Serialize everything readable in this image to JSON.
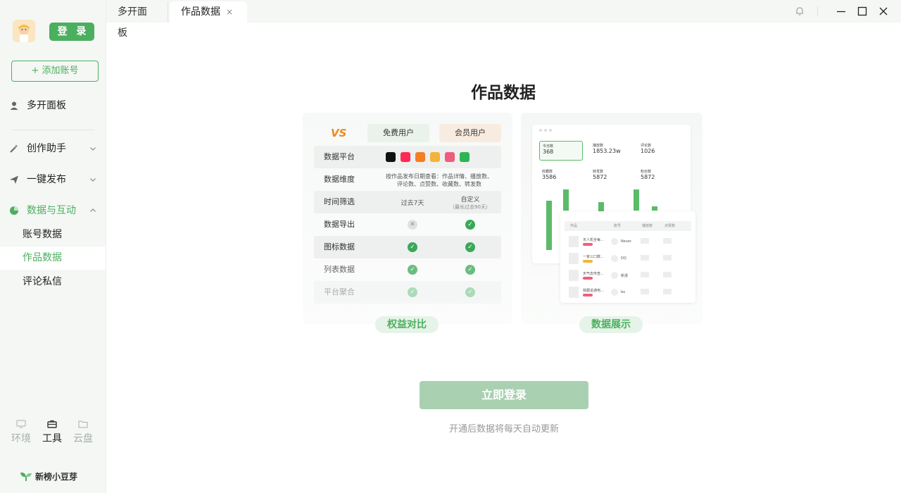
{
  "sidebar": {
    "login_label": "登 录",
    "add_account_label": "+ 添加账号",
    "nav": {
      "multi_panel": "多开面板",
      "creation_assistant": "创作助手",
      "one_click_publish": "一键发布",
      "data_interaction": "数据与互动"
    },
    "sub_items": [
      "账号数据",
      "作品数据",
      "评论私信"
    ],
    "bottom_tabs": [
      "环境",
      "工具",
      "云盘"
    ],
    "brand": "新榜小豆芽"
  },
  "tabs": [
    {
      "label": "多开面板"
    },
    {
      "label": "作品数据",
      "close": "×"
    }
  ],
  "main": {
    "title": "作品数据",
    "compare": {
      "vs": "VS",
      "free_header": "免费用户",
      "member_header": "会员用户",
      "rows": [
        {
          "label": "数据平台"
        },
        {
          "label": "数据维度",
          "free": "按作品发布日期查看：作品详情、播放数、评论数、点赞数、收藏数、转发数"
        },
        {
          "label": "时间筛选",
          "free": "过去7天",
          "member": "自定义",
          "member_note": "（最长过去90天）"
        },
        {
          "label": "数据导出",
          "free": "no",
          "member": "yes"
        },
        {
          "label": "图标数据",
          "free": "yes",
          "member": "yes"
        },
        {
          "label": "列表数据",
          "free": "yes",
          "member": "yes"
        },
        {
          "label": "平台聚合",
          "free": "yes",
          "member": "yes"
        }
      ]
    },
    "preview": {
      "stats": [
        {
          "label": "今日数",
          "value": "368"
        },
        {
          "label": "播放数",
          "value": "1853.23w"
        },
        {
          "label": "评论数",
          "value": "1026"
        },
        {
          "label": "收藏数",
          "value": "3586"
        },
        {
          "label": "转发数",
          "value": "5872"
        },
        {
          "label": "粉丝数",
          "value": "5872"
        }
      ],
      "table_headers": [
        "作品",
        "账号",
        "播放数",
        "点赞数"
      ],
      "table_rows": [
        {
          "title": "无人机全每...",
          "account": "Never"
        },
        {
          "title": "一家三口数...",
          "account": "DQ"
        },
        {
          "title": "天气去传查...",
          "account": "新漫"
        },
        {
          "title": "我跟说通电...",
          "account": "bo"
        }
      ]
    },
    "pill_compare": "权益对比",
    "pill_display": "数据展示",
    "cta_label": "立即登录",
    "note": "开通后数据将每天自动更新"
  },
  "colors": {
    "accent": "#4caf5f",
    "cta_disabled": "#a9d0b0"
  }
}
